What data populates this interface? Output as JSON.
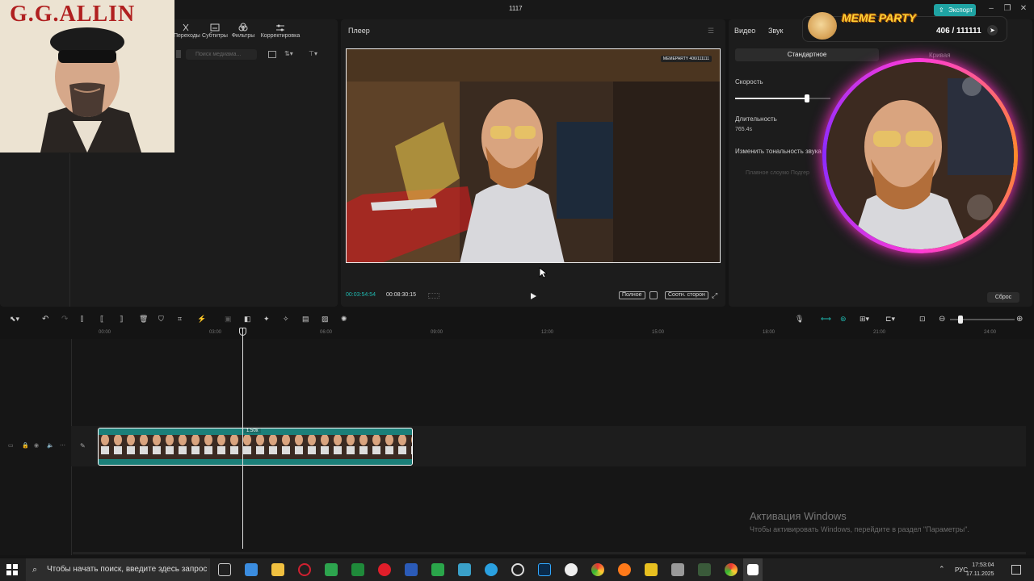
{
  "app": {
    "window_title": "1117",
    "export_label": "Экспорт"
  },
  "overlay_image": {
    "title": "G.G.ALLIN"
  },
  "media": {
    "tabs": [
      {
        "label": "Переходы"
      },
      {
        "label": "Субтитры"
      },
      {
        "label": "Фильтры"
      },
      {
        "label": "Корректировка"
      }
    ],
    "search_placeholder": "Поиск медиама..."
  },
  "player": {
    "label": "Плеер",
    "current_time": "00:03:54:54",
    "total_time": "00:08:30:15",
    "full_label": "Полное",
    "ratio_label": "Соотн. сторон",
    "video_watermark": "MEMEPARTY 406/111111"
  },
  "inspector": {
    "tabs": [
      {
        "label": "Видео"
      },
      {
        "label": "Звук"
      }
    ],
    "mode_standard": "Стандартное",
    "mode_curve": "Кривая",
    "speed_label": "Скорость",
    "speed_fraction": 0.75,
    "duration_label": "Длительность",
    "duration_value": "765.4s",
    "pitch_label": "Изменить тональность звука",
    "smooth_label": "Плавное слоумо Подгер",
    "reset_label": "Сброс"
  },
  "meme_overlay": {
    "title": "MEME PARTY",
    "count": "406 / 111111"
  },
  "timeline": {
    "ticks": [
      "00:00",
      "03:00",
      "06:00",
      "09:00",
      "12:00",
      "15:00",
      "18:00",
      "21:00",
      "24:00"
    ],
    "clip_speed_badge": "1.50x"
  },
  "windows_activation": {
    "title": "Активация Windows",
    "subtitle": "Чтобы активировать Windows, перейдите в раздел \"Параметры\"."
  },
  "taskbar": {
    "search_placeholder": "Чтобы начать поиск, введите здесь запрос",
    "language": "РУС",
    "time": "17:53:04",
    "date": "17.11.2025"
  }
}
